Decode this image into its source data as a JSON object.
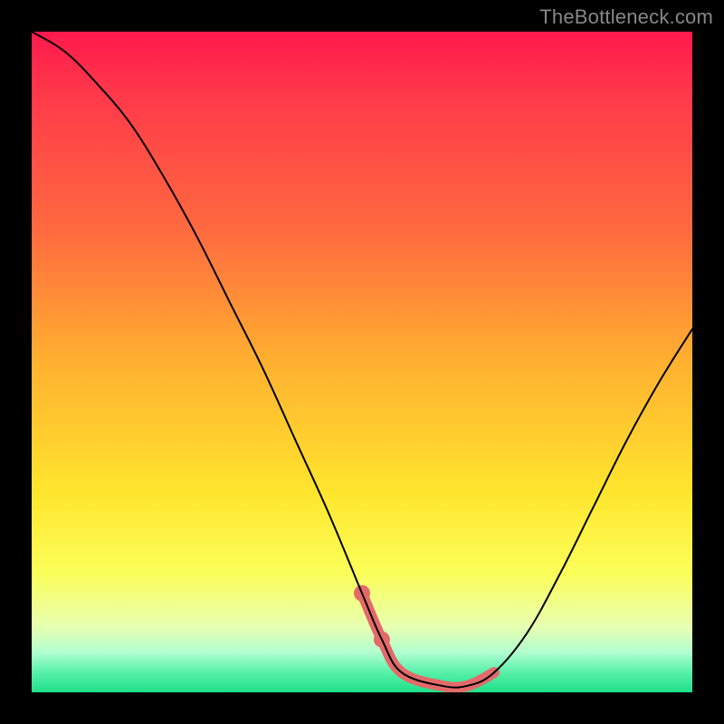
{
  "watermark": "TheBottleneck.com",
  "chart_data": {
    "type": "line",
    "title": "",
    "xlabel": "",
    "ylabel": "",
    "xlim": [
      0,
      100
    ],
    "ylim": [
      0,
      100
    ],
    "background_gradient": {
      "top": "#ff1a4d",
      "mid_upper": "#ffb030",
      "mid_lower": "#ffe62e",
      "bottom": "#1ee08a",
      "meaning": "red=high bottleneck, green=low bottleneck"
    },
    "series": [
      {
        "name": "bottleneck-curve",
        "color": "#000000",
        "stroke_width": 2,
        "x": [
          0,
          5,
          10,
          15,
          20,
          25,
          30,
          35,
          40,
          45,
          50,
          53,
          56,
          62,
          66,
          70,
          75,
          80,
          85,
          90,
          95,
          100
        ],
        "values": [
          100,
          97,
          92,
          86,
          78,
          69,
          59,
          49,
          38,
          27,
          15,
          8,
          3,
          1,
          1,
          3,
          9,
          18,
          28,
          38,
          47,
          55
        ]
      },
      {
        "name": "optimal-highlight",
        "color": "#e46a6a",
        "stroke_width": 12,
        "x": [
          50,
          53,
          56,
          62,
          66,
          70
        ],
        "values": [
          15,
          8,
          3,
          1,
          1,
          3
        ]
      }
    ],
    "highlight_dots": {
      "color": "#e46a6a",
      "radius": 9,
      "points": [
        {
          "x": 50,
          "y": 15
        },
        {
          "x": 53,
          "y": 8
        }
      ]
    }
  }
}
